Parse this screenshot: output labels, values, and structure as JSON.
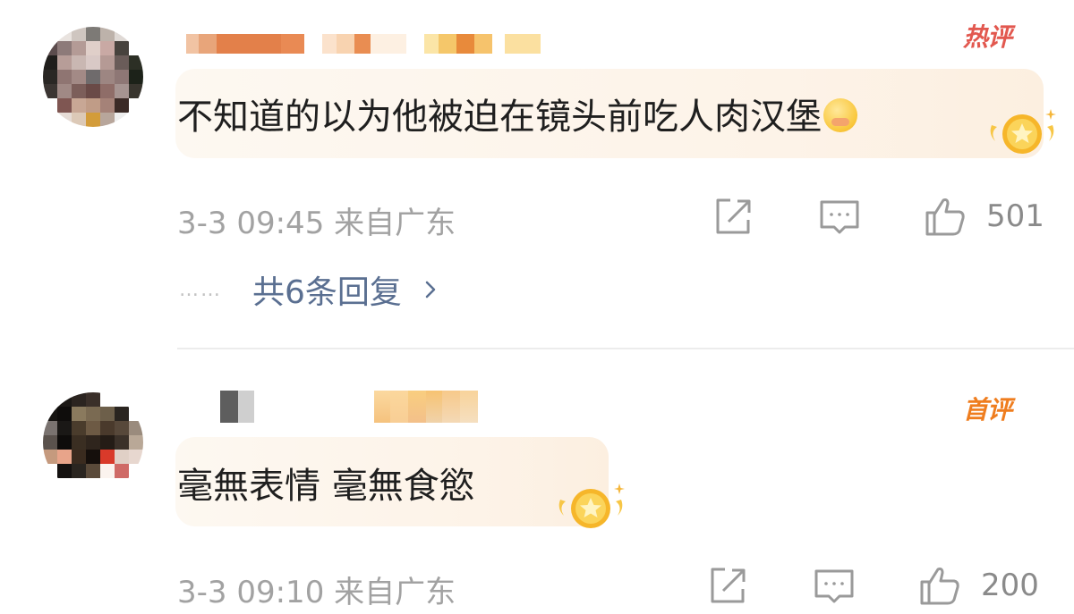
{
  "comments": [
    {
      "tag": "热评",
      "text": "不知道的以为他被迫在镜头前吃人肉汉堡",
      "meta": "3-3 09:45 来自广东",
      "likes": "501",
      "replies_label": "共6条回复",
      "replies_dots": "……",
      "emoji": "crying-emoji"
    },
    {
      "tag": "首评",
      "text": "毫無表情 毫無食慾",
      "meta": "3-3 09:10 来自广东",
      "likes": "200"
    }
  ],
  "colors": {
    "hot_tag": "#e2584f",
    "first_tag": "#ef7d1e",
    "bubble_bg": "#fdf5ec",
    "reply_link": "#5a6f91",
    "meta_text": "#a2a2a2"
  },
  "icons": {
    "share": "share-icon",
    "comment": "comment-icon",
    "like": "thumbs-up-icon",
    "badge": "gold-star-badge-icon",
    "chevron": "chevron-right-icon"
  }
}
